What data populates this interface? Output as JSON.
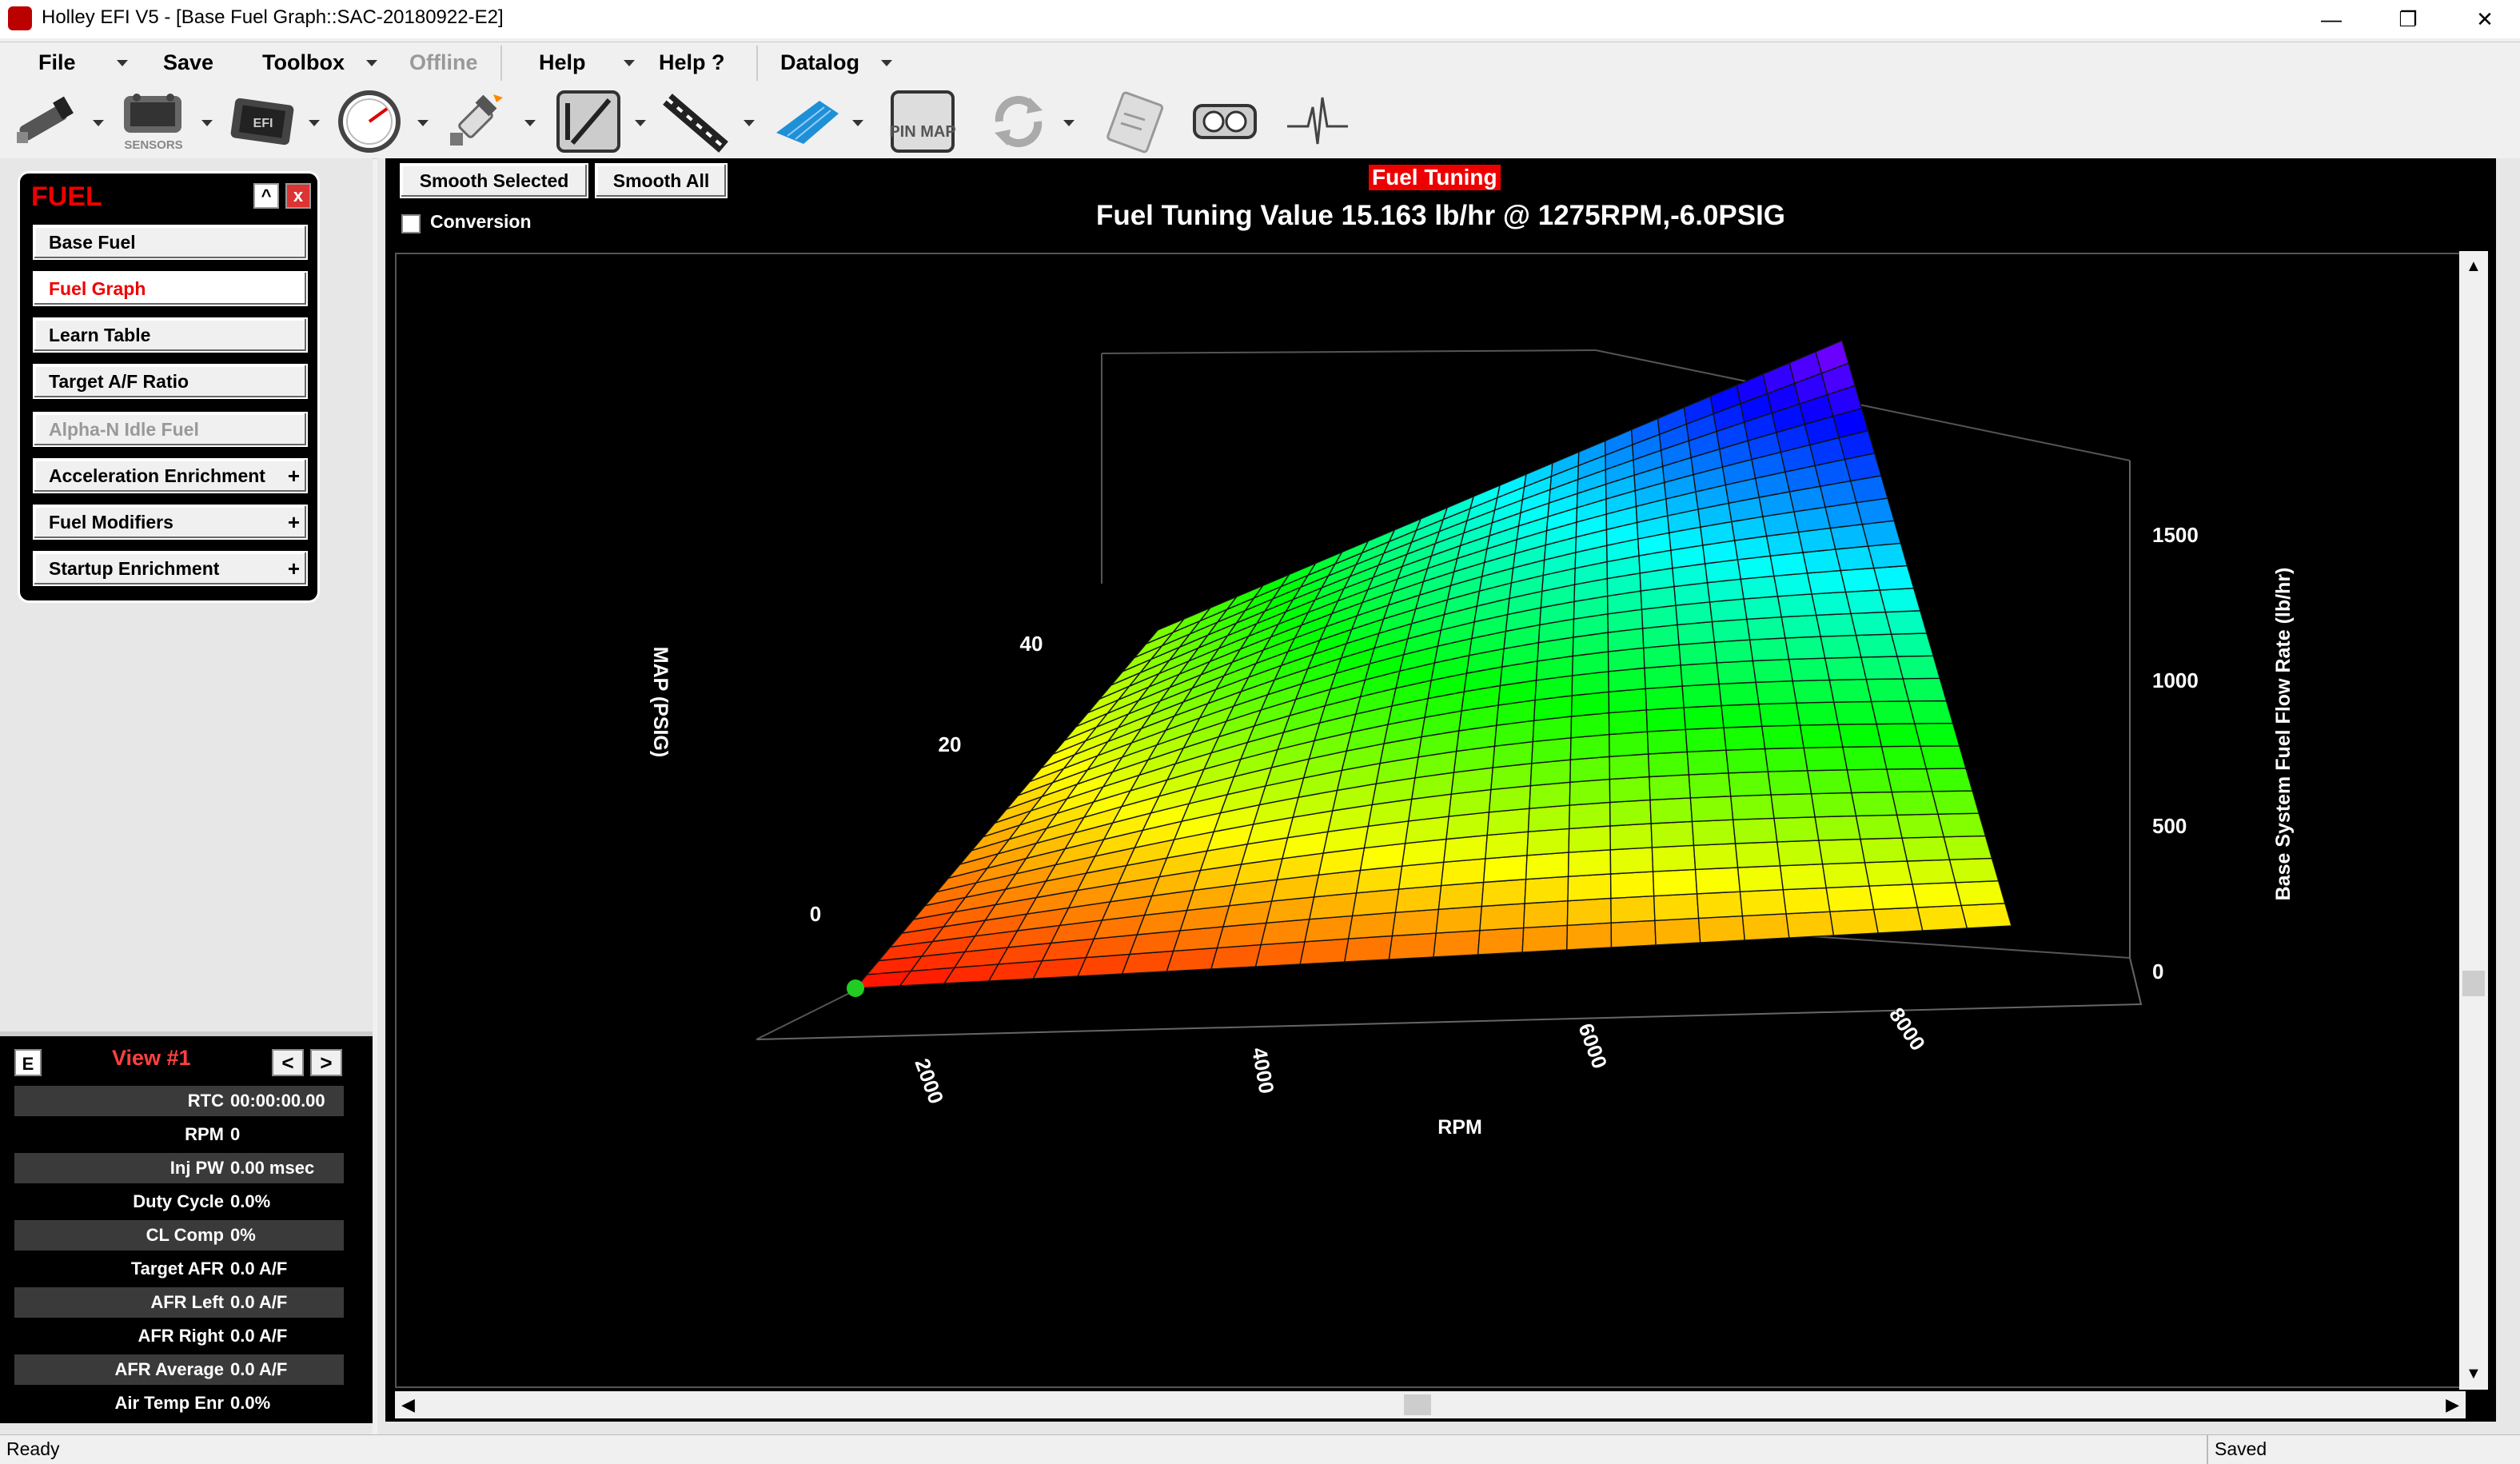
{
  "window": {
    "title": "Holley EFI V5 - [Base Fuel Graph::SAC-20180922-E2]",
    "controls": {
      "minimize": "—",
      "restore": "❐",
      "close": "✕"
    }
  },
  "menu": {
    "file": "File",
    "save": "Save",
    "toolbox": "Toolbox",
    "offline": "Offline",
    "help": "Help",
    "help_q": "Help ?",
    "datalog": "Datalog"
  },
  "toolbar": {
    "sensors_label": "SENSORS",
    "efi_label": "EFI",
    "pinmap_label": "PIN MAP",
    "icons": [
      "injector-icon",
      "sensors-icon",
      "ecu-icon",
      "gauge-icon",
      "spark-plug-icon",
      "slash-icon",
      "wiring-icon",
      "3d-graph-icon",
      "pin-map-icon",
      "refresh-icon",
      "notepad-icon",
      "dashboard-icon",
      "ekg-icon"
    ]
  },
  "nav": {
    "heading": "FUEL",
    "min_label": "^",
    "close_label": "x",
    "items": [
      {
        "label": "Base Fuel",
        "state": "normal",
        "expand": ""
      },
      {
        "label": "Fuel Graph",
        "state": "active",
        "expand": ""
      },
      {
        "label": "Learn Table",
        "state": "normal",
        "expand": ""
      },
      {
        "label": "Target A/F Ratio",
        "state": "normal",
        "expand": ""
      },
      {
        "label": "Alpha-N Idle Fuel",
        "state": "disabled",
        "expand": ""
      },
      {
        "label": "Acceleration Enrichment",
        "state": "normal",
        "expand": "+"
      },
      {
        "label": "Fuel Modifiers",
        "state": "normal",
        "expand": "+"
      },
      {
        "label": "Startup Enrichment",
        "state": "normal",
        "expand": "+"
      }
    ]
  },
  "view": {
    "e_label": "E",
    "title": "View #1",
    "prev": "<",
    "next": ">",
    "rows": [
      {
        "label": "RTC",
        "value": "00:00:00.00"
      },
      {
        "label": "RPM",
        "value": "0"
      },
      {
        "label": "Inj PW",
        "value": "0.00 msec"
      },
      {
        "label": "Duty Cycle",
        "value": "0.0%"
      },
      {
        "label": "CL Comp",
        "value": "0%"
      },
      {
        "label": "Target AFR",
        "value": "0.0 A/F"
      },
      {
        "label": "AFR Left",
        "value": "0.0 A/F"
      },
      {
        "label": "AFR Right",
        "value": "0.0 A/F"
      },
      {
        "label": "AFR Average",
        "value": "0.0 A/F"
      },
      {
        "label": "Air Temp Enr",
        "value": "0.0%"
      }
    ]
  },
  "graph_panel": {
    "smooth_selected": "Smooth Selected",
    "smooth_all": "Smooth All",
    "conversion": "Conversion",
    "section_title": "Fuel Tuning",
    "tuning_value": "Fuel Tuning Value 15.163 lb/hr @ 1275RPM,-6.0PSIG"
  },
  "chart_data": {
    "type": "surface",
    "xlabel": "RPM",
    "ylabel": "MAP (PSIG)",
    "zlabel": "Base System Fuel Flow Rate (lb/hr)",
    "x_ticks": [
      "2000",
      "4000",
      "6000",
      "8000"
    ],
    "y_ticks": [
      "0",
      "20",
      "40"
    ],
    "z_ticks": [
      "0",
      "500",
      "1000",
      "1500"
    ],
    "xlim": [
      1000,
      9000
    ],
    "ylim": [
      -14,
      50
    ],
    "zlim": [
      0,
      1700
    ],
    "colormap": "red-orange-yellow-green-cyan-blue-violet",
    "selected_point": {
      "x": 1275,
      "y": -6.0,
      "z": 15.163,
      "color": "#22cc22"
    },
    "corner_values": {
      "low_rpm_low_map": 15,
      "high_rpm_low_map": 300,
      "low_rpm_high_map": 520,
      "high_rpm_high_map": 1600
    }
  },
  "status": {
    "left": "Ready",
    "right": "Saved"
  }
}
